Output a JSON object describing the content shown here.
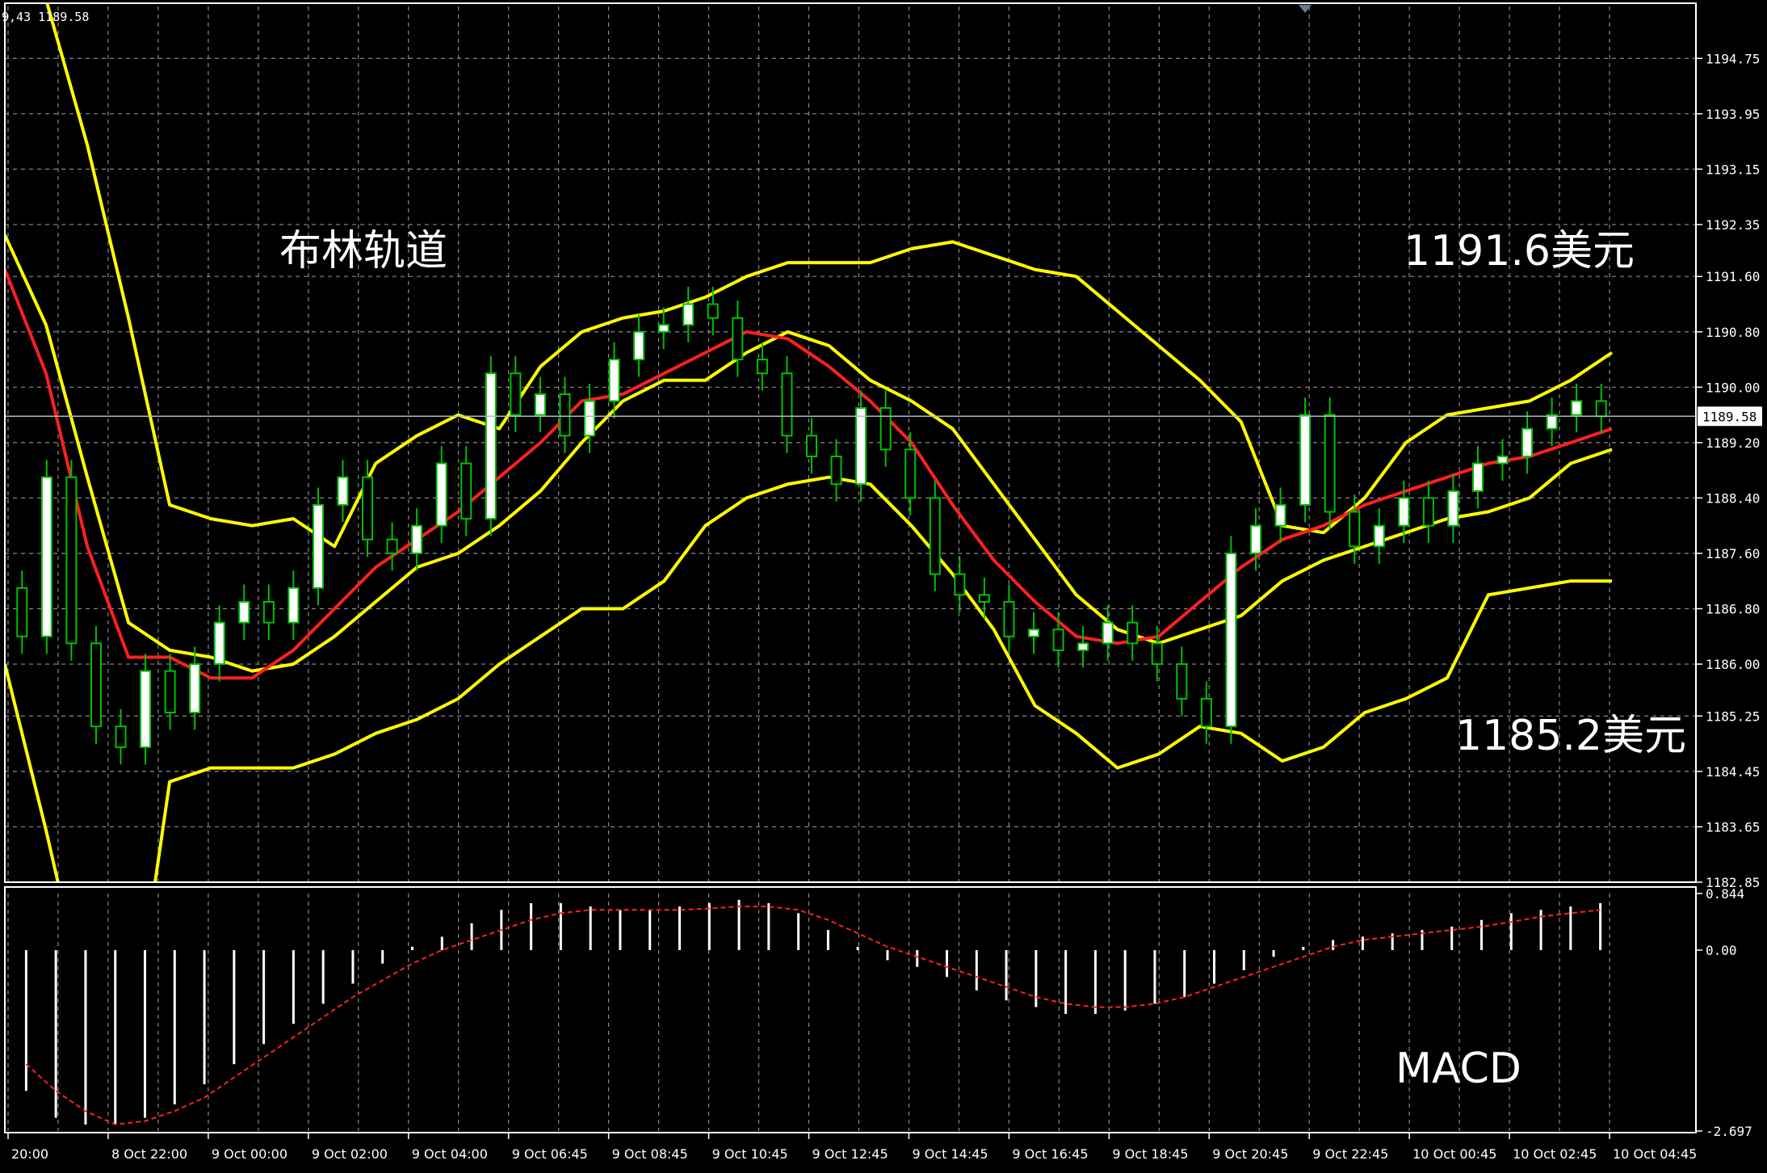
{
  "header_text": "9,43 1189.58",
  "annotations": {
    "bollinger_label": "布林轨道",
    "upper_price": "1191.6美元",
    "lower_price": "1185.2美元",
    "macd_label": "MACD"
  },
  "current_price_label": "1189.58",
  "colors": {
    "background": "#000000",
    "grid": "#8a8a8a",
    "bull_candle": "#ffffff",
    "wick": "#00c000",
    "bollinger": "#ffff00",
    "middle_ma": "#ff2020",
    "macd_hist": "#ffffff",
    "macd_signal": "#ff2020"
  },
  "chart_data": [
    {
      "type": "candlestick",
      "title": "",
      "ylim": [
        1182.85,
        1195.5
      ],
      "y_ticks": [
        "1194.75",
        "1193.95",
        "1193.15",
        "1192.35",
        "1191.60",
        "1190.80",
        "1190.00",
        "1189.20",
        "1188.40",
        "1187.60",
        "1186.80",
        "1186.00",
        "1185.25",
        "1184.45",
        "1183.65",
        "1182.85"
      ],
      "x_ticks": [
        "20:00",
        "8 Oct 22:00",
        "9 Oct 00:00",
        "9 Oct 02:00",
        "9 Oct 04:00",
        "9 Oct 06:45",
        "9 Oct 08:45",
        "9 Oct 10:45",
        "9 Oct 12:45",
        "9 Oct 14:45",
        "9 Oct 16:45",
        "9 Oct 18:45",
        "9 Oct 20:45",
        "9 Oct 22:45",
        "10 Oct 00:45",
        "10 Oct 02:45",
        "10 Oct 04:45"
      ],
      "current_price": 1189.58,
      "series": [
        {
          "name": "",
          "kind": "bollinger_upper",
          "x": [
            0,
            4,
            8,
            12,
            16,
            20,
            24,
            28,
            32,
            36,
            40,
            44,
            48,
            52,
            56,
            60,
            64,
            68,
            72,
            76,
            80,
            84,
            88,
            92,
            96,
            100,
            104,
            108,
            112,
            116,
            120,
            124,
            128,
            132,
            136,
            140,
            144,
            148,
            152,
            156
          ],
          "y": [
            1197.0,
            1195.6,
            1193.5,
            1191.0,
            1188.3,
            1188.1,
            1188.0,
            1188.1,
            1187.7,
            1188.9,
            1189.3,
            1189.6,
            1189.4,
            1190.3,
            1190.8,
            1191.0,
            1191.1,
            1191.3,
            1191.6,
            1191.8,
            1191.8,
            1191.8,
            1192.0,
            1192.1,
            1191.9,
            1191.7,
            1191.6,
            1191.1,
            1190.6,
            1190.1,
            1189.5,
            1188.0,
            1187.9,
            1188.4,
            1189.2,
            1189.6,
            1189.7,
            1189.8,
            1190.1,
            1190.5
          ]
        },
        {
          "name": "",
          "kind": "bollinger_middle",
          "x": [
            0,
            4,
            8,
            12,
            16,
            20,
            24,
            28,
            32,
            36,
            40,
            44,
            48,
            52,
            56,
            60,
            64,
            68,
            72,
            76,
            80,
            84,
            88,
            92,
            96,
            100,
            104,
            108,
            112,
            116,
            120,
            124,
            128,
            132,
            136,
            140,
            144,
            148,
            152,
            156
          ],
          "y": [
            1192.2,
            1190.9,
            1188.7,
            1186.6,
            1186.2,
            1186.1,
            1185.9,
            1186.0,
            1186.4,
            1186.9,
            1187.4,
            1187.6,
            1188.0,
            1188.5,
            1189.2,
            1189.8,
            1190.1,
            1190.1,
            1190.5,
            1190.8,
            1190.6,
            1190.1,
            1189.8,
            1189.4,
            1188.6,
            1187.8,
            1187.0,
            1186.5,
            1186.3,
            1186.5,
            1186.7,
            1187.2,
            1187.5,
            1187.7,
            1187.9,
            1188.1,
            1188.2,
            1188.4,
            1188.9,
            1189.1
          ]
        },
        {
          "name": "",
          "kind": "bollinger_lower",
          "x": [
            0,
            4,
            8,
            12,
            16,
            20,
            24,
            28,
            32,
            36,
            40,
            44,
            48,
            52,
            56,
            60,
            64,
            68,
            72,
            76,
            80,
            84,
            88,
            92,
            96,
            100,
            104,
            108,
            112,
            116,
            120,
            124,
            128,
            132,
            136,
            140,
            144,
            148,
            152,
            156
          ],
          "y": [
            1186.0,
            1183.6,
            1181.0,
            1180.2,
            1184.3,
            1184.5,
            1184.5,
            1184.5,
            1184.7,
            1185.0,
            1185.2,
            1185.5,
            1186.0,
            1186.4,
            1186.8,
            1186.8,
            1187.2,
            1188.0,
            1188.4,
            1188.6,
            1188.7,
            1188.6,
            1188.0,
            1187.3,
            1186.5,
            1185.4,
            1185.0,
            1184.5,
            1184.7,
            1185.1,
            1185.0,
            1184.6,
            1184.8,
            1185.3,
            1185.5,
            1185.8,
            1187.0,
            1187.1,
            1187.2,
            1187.2
          ]
        },
        {
          "name": "",
          "kind": "moving_average",
          "x": [
            0,
            4,
            8,
            12,
            16,
            20,
            24,
            28,
            32,
            36,
            40,
            44,
            48,
            52,
            56,
            60,
            64,
            68,
            72,
            76,
            80,
            84,
            88,
            92,
            96,
            100,
            104,
            108,
            112,
            116,
            120,
            124,
            128,
            132,
            136,
            140,
            144,
            148,
            152,
            156
          ],
          "y": [
            1191.7,
            1190.2,
            1187.7,
            1186.1,
            1186.1,
            1185.8,
            1185.8,
            1186.2,
            1186.8,
            1187.4,
            1187.8,
            1188.2,
            1188.7,
            1189.2,
            1189.8,
            1189.9,
            1190.2,
            1190.5,
            1190.8,
            1190.7,
            1190.3,
            1189.8,
            1189.2,
            1188.3,
            1187.5,
            1186.9,
            1186.4,
            1186.3,
            1186.4,
            1186.9,
            1187.4,
            1187.8,
            1188.0,
            1188.3,
            1188.5,
            1188.7,
            1188.9,
            1189.0,
            1189.2,
            1189.4
          ]
        },
        {
          "name": "",
          "kind": "candles",
          "open": [
            1187.1,
            1186.4,
            1188.7,
            1186.3,
            1185.1,
            1184.8,
            1185.9,
            1185.3,
            1186.0,
            1186.6,
            1186.9,
            1186.6,
            1187.1,
            1188.3,
            1188.7,
            1187.8,
            1187.6,
            1188.0,
            1188.9,
            1188.1,
            1190.2,
            1189.6,
            1189.9,
            1189.3,
            1189.8,
            1190.4,
            1190.8,
            1190.9,
            1191.2,
            1191.0,
            1190.4,
            1190.2,
            1189.3,
            1189.0,
            1188.6,
            1189.7,
            1189.1,
            1188.4,
            1187.3,
            1187.0,
            1186.9,
            1186.4,
            1186.5,
            1186.2,
            1186.3,
            1186.6,
            1186.3,
            1186.0,
            1185.5,
            1185.1,
            1187.6,
            1188.0,
            1188.3,
            1189.6,
            1188.2,
            1187.7,
            1188.0,
            1188.4,
            1188.0,
            1188.5,
            1188.9,
            1189.0,
            1189.4,
            1189.6,
            1189.8
          ],
          "close": [
            1186.4,
            1188.7,
            1186.3,
            1185.1,
            1184.8,
            1185.9,
            1185.3,
            1186.0,
            1186.6,
            1186.9,
            1186.6,
            1187.1,
            1188.3,
            1188.7,
            1187.8,
            1187.6,
            1188.0,
            1188.9,
            1188.1,
            1190.2,
            1189.6,
            1189.9,
            1189.3,
            1189.8,
            1190.4,
            1190.8,
            1190.9,
            1191.2,
            1191.0,
            1190.4,
            1190.2,
            1189.3,
            1189.0,
            1188.6,
            1189.7,
            1189.1,
            1188.4,
            1187.3,
            1187.0,
            1186.9,
            1186.4,
            1186.5,
            1186.2,
            1186.3,
            1186.6,
            1186.3,
            1186.0,
            1185.5,
            1185.1,
            1187.6,
            1188.0,
            1188.3,
            1189.6,
            1188.2,
            1187.7,
            1188.0,
            1188.4,
            1188.0,
            1188.5,
            1188.9,
            1189.0,
            1189.4,
            1189.6,
            1189.8,
            1189.58
          ]
        }
      ]
    },
    {
      "type": "bar",
      "title": "MACD",
      "ylim": [
        -2.697,
        0.844
      ],
      "y_ticks": [
        "0.844",
        "0.00",
        "-2.697"
      ],
      "series": [
        {
          "name": "",
          "kind": "histogram",
          "values": [
            -2.1,
            -2.5,
            -2.6,
            -2.6,
            -2.5,
            -2.3,
            -2.0,
            -1.7,
            -1.4,
            -1.1,
            -0.8,
            -0.5,
            -0.2,
            0.05,
            0.2,
            0.4,
            0.6,
            0.7,
            0.7,
            0.65,
            0.6,
            0.6,
            0.65,
            0.7,
            0.75,
            0.7,
            0.55,
            0.3,
            0.05,
            -0.15,
            -0.25,
            -0.4,
            -0.6,
            -0.75,
            -0.85,
            -0.95,
            -0.95,
            -0.9,
            -0.8,
            -0.7,
            -0.5,
            -0.3,
            -0.1,
            0.05,
            0.15,
            0.2,
            0.25,
            0.3,
            0.35,
            0.45,
            0.55,
            0.6,
            0.65,
            0.7
          ]
        },
        {
          "name": "",
          "kind": "signal",
          "values": [
            -1.7,
            -2.1,
            -2.4,
            -2.6,
            -2.55,
            -2.4,
            -2.2,
            -1.9,
            -1.6,
            -1.3,
            -1.0,
            -0.7,
            -0.45,
            -0.2,
            0.0,
            0.15,
            0.3,
            0.45,
            0.55,
            0.6,
            0.6,
            0.6,
            0.6,
            0.62,
            0.65,
            0.65,
            0.6,
            0.45,
            0.25,
            0.05,
            -0.1,
            -0.25,
            -0.4,
            -0.55,
            -0.7,
            -0.8,
            -0.85,
            -0.85,
            -0.8,
            -0.7,
            -0.55,
            -0.4,
            -0.25,
            -0.1,
            0.05,
            0.15,
            0.2,
            0.25,
            0.3,
            0.35,
            0.42,
            0.5,
            0.55,
            0.6
          ]
        }
      ]
    }
  ]
}
